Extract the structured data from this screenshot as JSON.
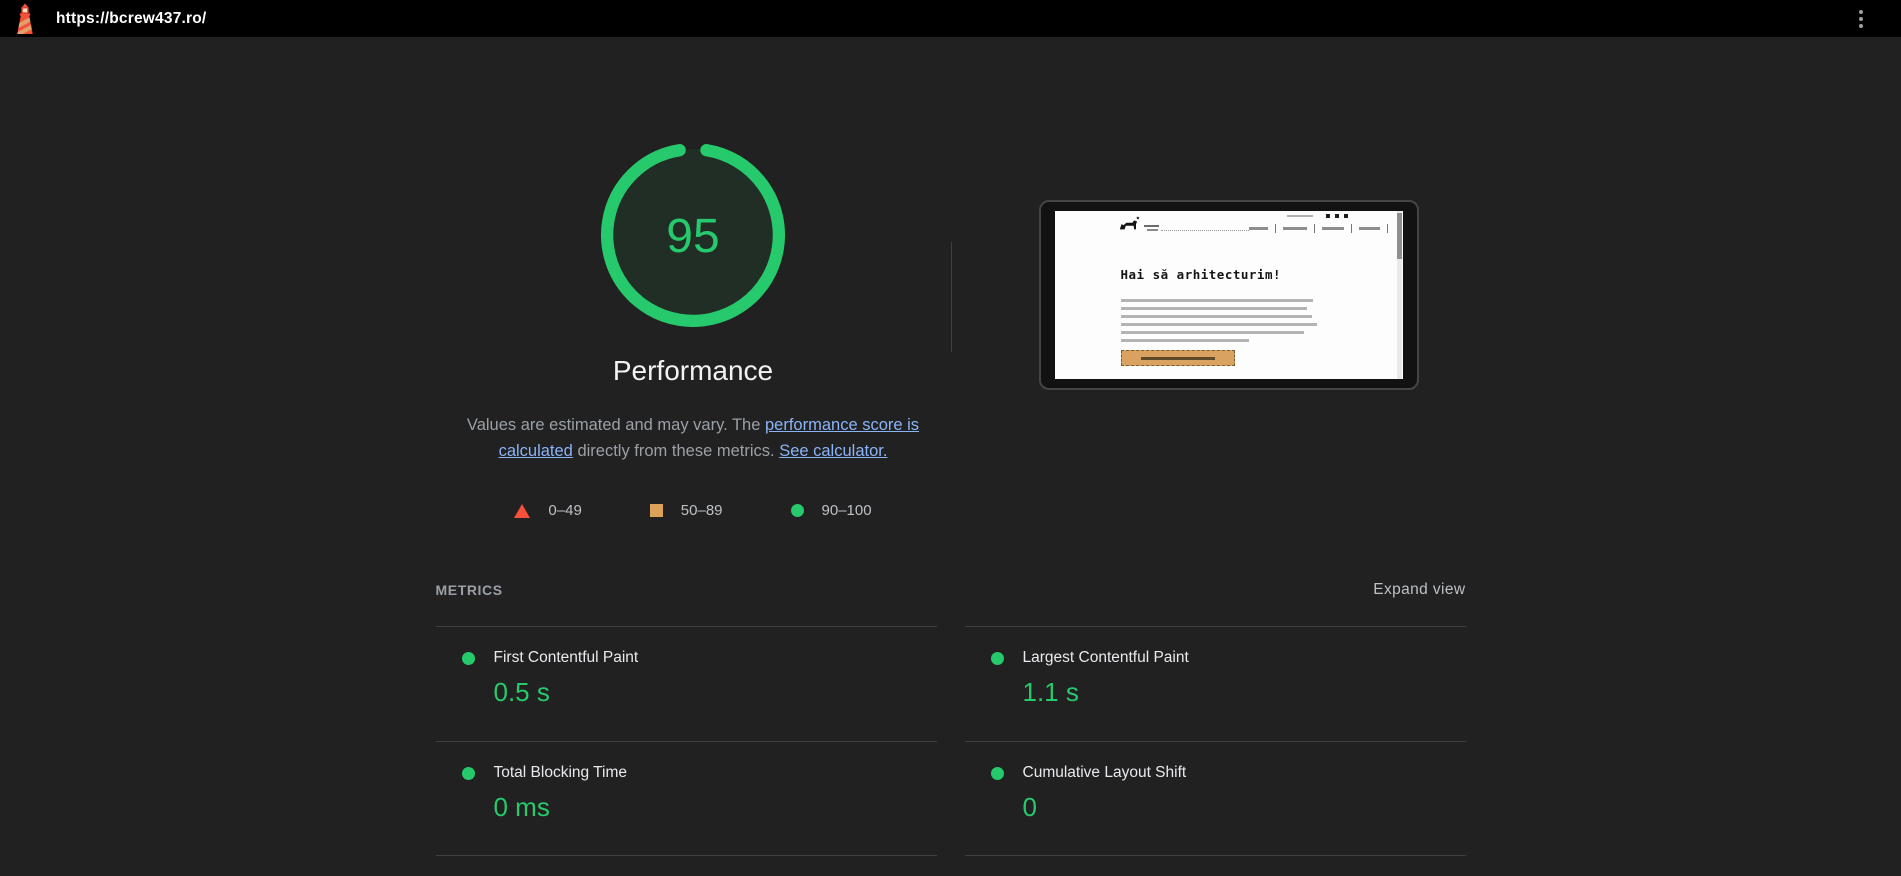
{
  "topbar": {
    "url": "https://bcrew437.ro/"
  },
  "score": {
    "value": "95",
    "max": 100,
    "title": "Performance",
    "description": {
      "pre": "Values are estimated and may vary. The ",
      "link1": "performance score is calculated",
      "mid": " directly from these metrics. ",
      "link2": "See calculator."
    },
    "legend": [
      {
        "shape": "triangle",
        "color": "#f4503a",
        "label": "0–49"
      },
      {
        "shape": "square",
        "color": "#dca259",
        "label": "50–89"
      },
      {
        "shape": "circle",
        "color": "#26c96b",
        "label": "90–100"
      }
    ]
  },
  "screenshot": {
    "heading": "Hai să arhitecturim!"
  },
  "metrics": {
    "section_title": "METRICS",
    "expand_label": "Expand view",
    "items": [
      {
        "label": "First Contentful Paint",
        "value": "0.5 s",
        "status": "pass"
      },
      {
        "label": "Largest Contentful Paint",
        "value": "1.1 s",
        "status": "pass"
      },
      {
        "label": "Total Blocking Time",
        "value": "0 ms",
        "status": "pass"
      },
      {
        "label": "Cumulative Layout Shift",
        "value": "0",
        "status": "pass"
      }
    ]
  },
  "colors": {
    "pass_green": "#26c96b",
    "average_orange": "#dca259",
    "fail_red": "#f4503a",
    "background": "#212121",
    "topbar": "#000000",
    "link_blue": "#8ab4f8"
  }
}
